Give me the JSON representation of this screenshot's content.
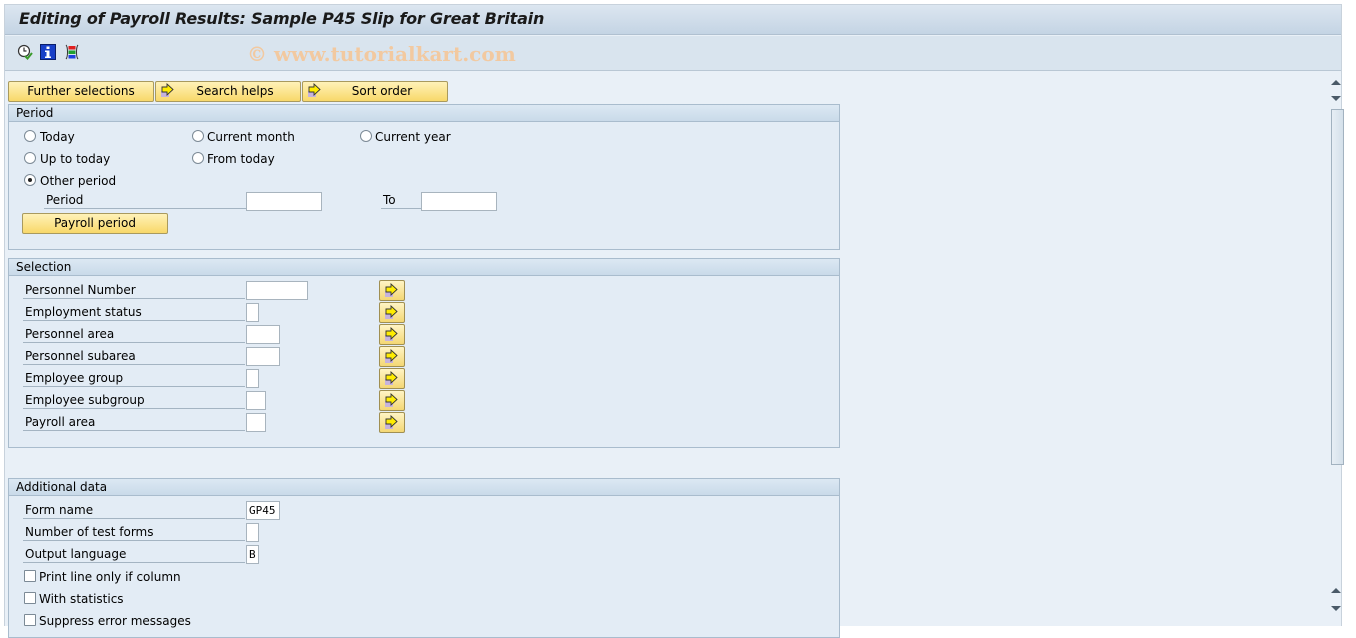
{
  "window": {
    "title": "Editing of Payroll Results: Sample P45 Slip for Great Britain",
    "watermark": "© www.tutorialkart.com"
  },
  "toolbar": {
    "icons": [
      "execute-clock-icon",
      "info-icon",
      "selection-options-icon"
    ]
  },
  "action_buttons": {
    "further_selections": "Further selections",
    "search_helps": "Search helps",
    "sort_order": "Sort order"
  },
  "period": {
    "header": "Period",
    "options": {
      "today": "Today",
      "current_month": "Current month",
      "current_year": "Current year",
      "up_to_today": "Up to today",
      "from_today": "From today",
      "other_period": "Other period"
    },
    "selected": "other_period",
    "period_label": "Period",
    "period_from_value": "",
    "to_label": "To",
    "period_to_value": "",
    "payroll_period_button": "Payroll period"
  },
  "selection": {
    "header": "Selection",
    "fields": [
      {
        "label": "Personnel Number",
        "value": ""
      },
      {
        "label": "Employment status",
        "value": ""
      },
      {
        "label": "Personnel area",
        "value": ""
      },
      {
        "label": "Personnel subarea",
        "value": ""
      },
      {
        "label": "Employee group",
        "value": ""
      },
      {
        "label": "Employee subgroup",
        "value": ""
      },
      {
        "label": "Payroll area",
        "value": ""
      }
    ]
  },
  "additional": {
    "header": "Additional data",
    "form_name_label": "Form name",
    "form_name_value": "GP45",
    "test_forms_label": "Number of test forms",
    "test_forms_value": "",
    "output_language_label": "Output language",
    "output_language_value": "B",
    "checkboxes": [
      {
        "label": "Print line only if column",
        "checked": false
      },
      {
        "label": "With statistics",
        "checked": false
      },
      {
        "label": "Suppress error messages",
        "checked": false
      }
    ]
  }
}
